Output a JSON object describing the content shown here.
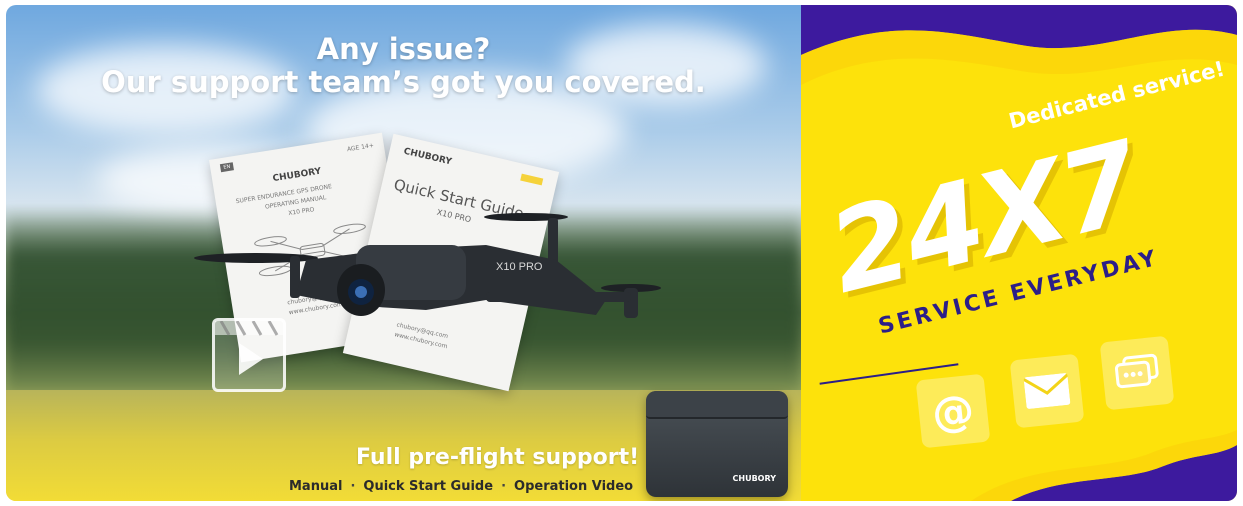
{
  "left_panel": {
    "headline_line1": "Any issue?",
    "headline_line2": "Our support team’s got you covered.",
    "manual_doc": {
      "brand": "CHUBORY",
      "age": "AGE 14+",
      "line1": "SUPER ENDURANCE GPS DRONE",
      "line2": "OPERATING MANUAL",
      "line3": "X10 PRO",
      "email": "chubory@qq.com",
      "site": "www.chubory.com"
    },
    "quick_guide_doc": {
      "brand": "CHUBORY",
      "title": "Quick Start Guide",
      "model": "X10 PRO",
      "email": "chubory@qq.com",
      "site": "www.chubory.com"
    },
    "drone_model": "X10 PRO",
    "bag_brand": "CHUBORY",
    "support_title": "Full pre-flight support!",
    "support_links": [
      "Manual",
      "Quick Start Guide",
      "Operation Video"
    ],
    "separator": "·"
  },
  "right_panel": {
    "dedicated": "Dedicated service!",
    "big_text": "24X7",
    "service_everyday": "SERVICE EVERYDAY",
    "icons": [
      "at-sign-icon",
      "envelope-icon",
      "chat-bubble-icon"
    ],
    "at_glyph": "@"
  },
  "colors": {
    "yellow": "#fde20b",
    "purple": "#3d1a9e",
    "navy_text": "#2c1e88",
    "white": "#ffffff"
  }
}
